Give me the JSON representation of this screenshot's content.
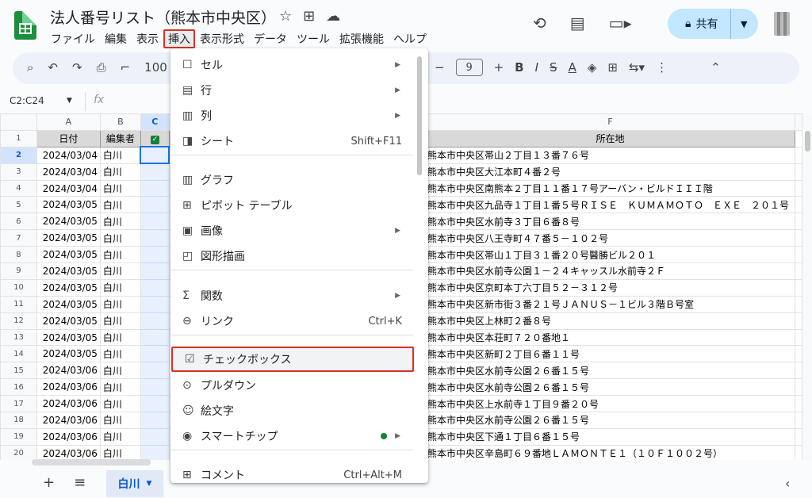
{
  "doc": {
    "title": "法人番号リスト（熊本市中央区）"
  },
  "menubar": [
    "ファイル",
    "編集",
    "表示",
    "挿入",
    "表示形式",
    "データ",
    "ツール",
    "拡張機能",
    "ヘルプ"
  ],
  "share": {
    "label": "共有"
  },
  "toolbar": {
    "zoom": "100",
    "font_size": "9"
  },
  "namebox": "C2:C24",
  "fx": "fx",
  "columns": [
    "A",
    "B",
    "C",
    "F"
  ],
  "header_row": {
    "date": "日付",
    "editor": "編集者",
    "address": "所在地"
  },
  "rows": [
    {
      "n": "2",
      "date": "2024/03/04",
      "editor": "白川",
      "address": "熊本市中央区帯山２丁目１３番７６号"
    },
    {
      "n": "3",
      "date": "2024/03/04",
      "editor": "白川",
      "address": "熊本市中央区大江本町４番２号"
    },
    {
      "n": "4",
      "date": "2024/03/04",
      "editor": "白川",
      "address": "熊本市中央区南熊本２丁目１１番１７号アーバン・ビルドＩＩＩ階"
    },
    {
      "n": "5",
      "date": "2024/03/05",
      "editor": "白川",
      "address": "熊本市中央区九品寺１丁目１番５号ＲＩＳＥ　ＫＵＭＡＭＯＴＯ　ＥＸＥ　２０１号"
    },
    {
      "n": "6",
      "date": "2024/03/05",
      "editor": "白川",
      "address": "熊本市中央区水前寺３丁目６番８号"
    },
    {
      "n": "7",
      "date": "2024/03/05",
      "editor": "白川",
      "address": "熊本市中央区八王寺町４７番５－１０２号"
    },
    {
      "n": "8",
      "date": "2024/03/05",
      "editor": "白川",
      "address": "熊本市中央区帯山１丁目３１番２０号醫勝ビル２０１"
    },
    {
      "n": "9",
      "date": "2024/03/05",
      "editor": "白川",
      "address": "熊本市中央区水前寺公園１－２４キャッスル水前寺２Ｆ"
    },
    {
      "n": "10",
      "date": "2024/03/05",
      "editor": "白川",
      "address": "熊本市中央区京町本丁六丁目５２－３１２号"
    },
    {
      "n": "11",
      "date": "2024/03/05",
      "editor": "白川",
      "address": "熊本市中央区新市街３番２１号ＪＡＮＵＳ－１ビル３階Ｂ号室"
    },
    {
      "n": "12",
      "date": "2024/03/05",
      "editor": "白川",
      "address": "熊本市中央区上林町２番８号"
    },
    {
      "n": "13",
      "date": "2024/03/05",
      "editor": "白川",
      "address": "熊本市中央区本荘町７２０番地１"
    },
    {
      "n": "14",
      "date": "2024/03/05",
      "editor": "白川",
      "address": "熊本市中央区新町２丁目６番１１号"
    },
    {
      "n": "15",
      "date": "2024/03/06",
      "editor": "白川",
      "address": "熊本市中央区水前寺公園２６番１５号"
    },
    {
      "n": "16",
      "date": "2024/03/06",
      "editor": "白川",
      "address": "熊本市中央区水前寺公園２６番１５号"
    },
    {
      "n": "17",
      "date": "2024/03/06",
      "editor": "白川",
      "address": "熊本市中央区上水前寺１丁目９番２０号"
    },
    {
      "n": "18",
      "date": "2024/03/06",
      "editor": "白川",
      "address": "熊本市中央区水前寺公園２６番１５号"
    },
    {
      "n": "19",
      "date": "2024/03/06",
      "editor": "白川",
      "address": "熊本市中央区下通１丁目６番１５号"
    },
    {
      "n": "20",
      "date": "2024/03/06",
      "editor": "白川",
      "address": "熊本市中央区辛島町６９番地ＬＡＭＯＮＴＥ１（１０Ｆ１００２号）"
    }
  ],
  "menu": {
    "items": [
      {
        "label": "セル",
        "icon": "cell-icon",
        "submenu": true
      },
      {
        "label": "行",
        "icon": "row-icon",
        "submenu": true
      },
      {
        "label": "列",
        "icon": "column-icon",
        "submenu": true
      },
      {
        "label": "シート",
        "icon": "sheet-icon",
        "shortcut": "Shift+F11"
      },
      {
        "label": "グラフ",
        "icon": "chart-icon"
      },
      {
        "label": "ピボット テーブル",
        "icon": "pivot-icon"
      },
      {
        "label": "画像",
        "icon": "image-icon",
        "submenu": true
      },
      {
        "label": "図形描画",
        "icon": "drawing-icon"
      },
      {
        "label": "関数",
        "icon": "function-icon",
        "submenu": true
      },
      {
        "label": "リンク",
        "icon": "link-icon",
        "shortcut": "Ctrl+K"
      },
      {
        "label": "チェックボックス",
        "icon": "checkbox-icon",
        "highlighted": true
      },
      {
        "label": "プルダウン",
        "icon": "dropdown-icon"
      },
      {
        "label": "絵文字",
        "icon": "emoji-icon"
      },
      {
        "label": "スマートチップ",
        "icon": "smart-chip-icon",
        "submenu": true
      },
      {
        "label": "コメント",
        "icon": "comment-icon",
        "shortcut": "Ctrl+Alt+M"
      }
    ]
  },
  "sheet_tab": {
    "label": "白川"
  },
  "colors": {
    "accent": "#0b57d0",
    "highlight_border": "#d93025",
    "share_bg": "#c2e7ff",
    "logo": "#1e8e3e"
  }
}
